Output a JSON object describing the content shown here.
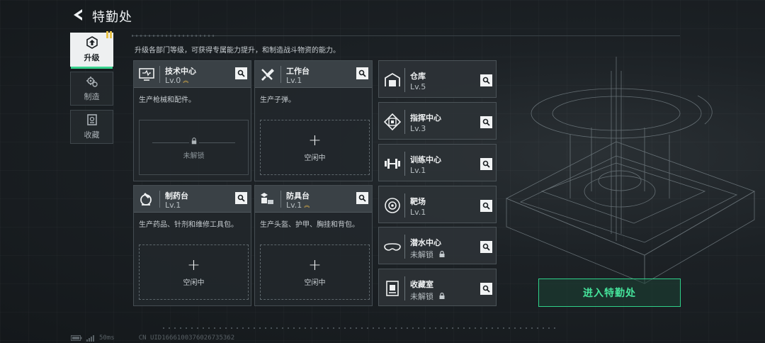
{
  "header": {
    "title": "特勤处"
  },
  "sidebar": {
    "tabs": [
      {
        "label": "升级",
        "icon": "upgrade-icon",
        "active": true
      },
      {
        "label": "制造",
        "icon": "manufacture-icon",
        "active": false
      },
      {
        "label": "收藏",
        "icon": "collection-icon",
        "active": false
      }
    ]
  },
  "description": "升级各部门等级，可获得专属能力提升，和制造战斗物资的能力。",
  "departments": [
    {
      "name": "技术中心",
      "level": "Lv.0",
      "upgradable": true,
      "desc": "生产枪械和配件。",
      "slot": "未解锁",
      "slot_state": "locked",
      "icon": "tech-center-icon"
    },
    {
      "name": "工作台",
      "level": "Lv.1",
      "upgradable": false,
      "desc": "生产子弹。",
      "slot": "空闲中",
      "slot_state": "idle",
      "icon": "workbench-icon"
    },
    {
      "name": "制药台",
      "level": "Lv.1",
      "upgradable": false,
      "desc": "生产药品、针剂和维修工具包。",
      "slot": "空闲中",
      "slot_state": "idle",
      "icon": "pharmacy-icon"
    },
    {
      "name": "防具台",
      "level": "Lv.1",
      "upgradable": true,
      "desc": "生产头盔、护甲、胸挂和背包。",
      "slot": "空闲中",
      "slot_state": "idle",
      "icon": "armor-bench-icon"
    }
  ],
  "facilities": [
    {
      "name": "仓库",
      "level": "Lv.5",
      "locked": false,
      "icon": "warehouse-icon"
    },
    {
      "name": "指挥中心",
      "level": "Lv.3",
      "locked": false,
      "icon": "command-center-icon"
    },
    {
      "name": "训练中心",
      "level": "Lv.1",
      "locked": false,
      "icon": "dumbbell-icon"
    },
    {
      "name": "靶场",
      "level": "Lv.1",
      "locked": false,
      "icon": "target-icon"
    },
    {
      "name": "潜水中心",
      "level": "未解锁",
      "locked": true,
      "icon": "diving-mask-icon"
    },
    {
      "name": "收藏室",
      "level": "未解锁",
      "locked": true,
      "icon": "display-case-icon"
    }
  ],
  "enter_button": "进入特勤处",
  "footer": {
    "ping": "50ms",
    "uid": "CN UID1666100376026735362"
  },
  "colors": {
    "accent_green": "#38d28e",
    "upgrade_gold": "#e8b84a"
  }
}
